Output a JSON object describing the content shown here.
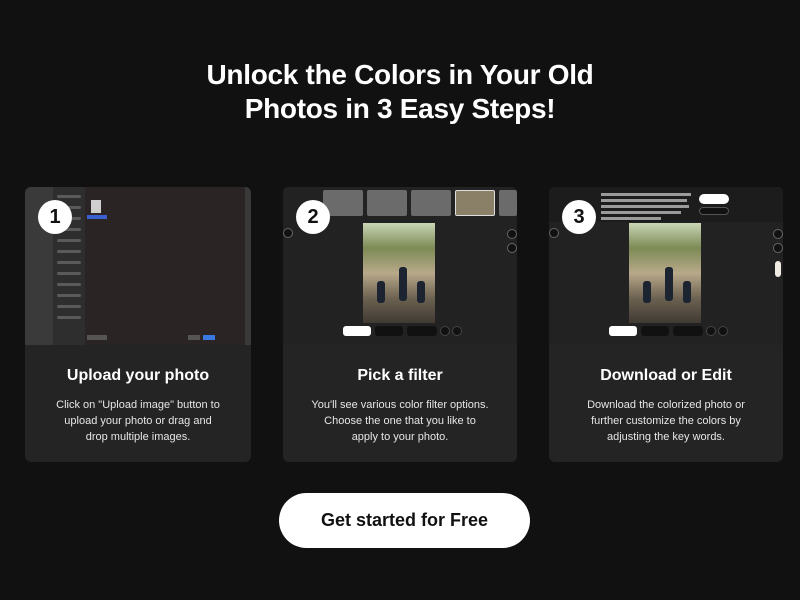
{
  "headline": {
    "line1": "Unlock the Colors in Your Old",
    "line2": "Photos in 3 Easy Steps!"
  },
  "steps": [
    {
      "number": "1",
      "title": "Upload your photo",
      "desc_lines": [
        "Click on \"Upload image\" button to",
        "upload your photo or drag and",
        "drop multiple images."
      ]
    },
    {
      "number": "2",
      "title": "Pick a filter",
      "desc_lines": [
        "You'll see various color filter options.",
        "Choose the one that you like to",
        "apply to your photo."
      ]
    },
    {
      "number": "3",
      "title": "Download or Edit",
      "desc_lines": [
        "Download the colorized photo or",
        "further customize the colors by",
        "adjusting the key words."
      ]
    }
  ],
  "cta": {
    "label": "Get started for Free"
  },
  "colors": {
    "background": "#111111",
    "card": "#242424",
    "cta_bg": "#ffffff",
    "cta_text": "#111111"
  }
}
